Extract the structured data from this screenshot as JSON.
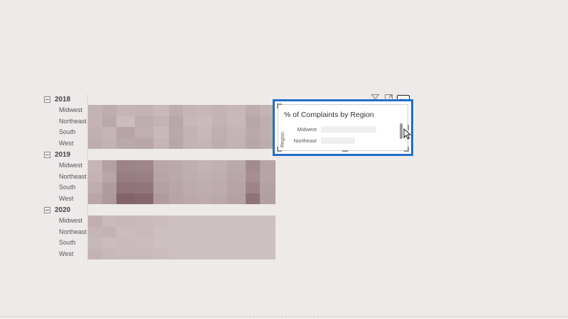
{
  "colors": {
    "accent": "#1f6fc7",
    "heat_low": "#e2d9da",
    "heat_high": "#7a5a5f"
  },
  "matrix": {
    "groups": [
      {
        "year": "2018",
        "regions": [
          "Midwest",
          "Northeast",
          "South",
          "West"
        ]
      },
      {
        "year": "2019",
        "regions": [
          "Midwest",
          "Northeast",
          "South",
          "West"
        ]
      },
      {
        "year": "2020",
        "regions": [
          "Midwest",
          "Northeast",
          "South",
          "West"
        ]
      }
    ],
    "intensity": [
      [
        [
          0.3,
          0.35,
          0.28,
          0.3,
          0.25,
          0.35,
          0.28,
          0.27,
          0.3,
          0.27,
          0.36,
          0.3,
          0.22,
          0.26
        ],
        [
          0.3,
          0.38,
          0.22,
          0.35,
          0.3,
          0.4,
          0.26,
          0.23,
          0.3,
          0.26,
          0.4,
          0.34,
          0.2,
          0.25
        ],
        [
          0.32,
          0.28,
          0.42,
          0.33,
          0.25,
          0.38,
          0.3,
          0.26,
          0.33,
          0.29,
          0.38,
          0.33,
          0.22,
          0.27
        ],
        [
          0.35,
          0.3,
          0.38,
          0.4,
          0.28,
          0.4,
          0.3,
          0.28,
          0.35,
          0.3,
          0.4,
          0.35,
          0.24,
          0.28
        ]
      ],
      [
        [
          0.28,
          0.45,
          0.68,
          0.66,
          0.4,
          0.38,
          0.33,
          0.3,
          0.32,
          0.38,
          0.62,
          0.42,
          0.3,
          0.2
        ],
        [
          0.3,
          0.4,
          0.72,
          0.7,
          0.42,
          0.38,
          0.34,
          0.32,
          0.34,
          0.4,
          0.58,
          0.42,
          0.28,
          0.2
        ],
        [
          0.35,
          0.48,
          0.8,
          0.78,
          0.45,
          0.4,
          0.36,
          0.34,
          0.36,
          0.42,
          0.66,
          0.44,
          0.3,
          0.22
        ],
        [
          0.4,
          0.5,
          0.92,
          0.88,
          0.48,
          0.42,
          0.38,
          0.36,
          0.38,
          0.44,
          0.8,
          0.46,
          0.32,
          0.22
        ]
      ],
      [
        [
          0.32,
          0.24,
          0.26,
          0.24,
          0.22,
          0.2,
          0.2,
          0.2,
          0.2,
          0.2,
          0.2,
          0.2,
          0.2,
          0.2
        ],
        [
          0.28,
          0.3,
          0.22,
          0.24,
          0.2,
          0.2,
          0.2,
          0.2,
          0.2,
          0.2,
          0.2,
          0.2,
          0.2,
          0.2
        ],
        [
          0.26,
          0.22,
          0.24,
          0.22,
          0.2,
          0.2,
          0.2,
          0.2,
          0.2,
          0.2,
          0.2,
          0.2,
          0.2,
          0.2
        ],
        [
          0.3,
          0.26,
          0.24,
          0.24,
          0.22,
          0.2,
          0.2,
          0.2,
          0.2,
          0.2,
          0.2,
          0.2,
          0.2,
          0.2
        ]
      ]
    ]
  },
  "visual": {
    "title": "% of Complaints by Region",
    "y_axis_title": "Region",
    "bars": [
      {
        "label": "Midwest",
        "value": 1.0
      },
      {
        "label": "Northeast",
        "value": 0.62
      }
    ]
  },
  "toolbar": {
    "icons": [
      "filter-icon",
      "focus-mode-icon",
      "more-options-icon"
    ],
    "more_label": "···"
  }
}
